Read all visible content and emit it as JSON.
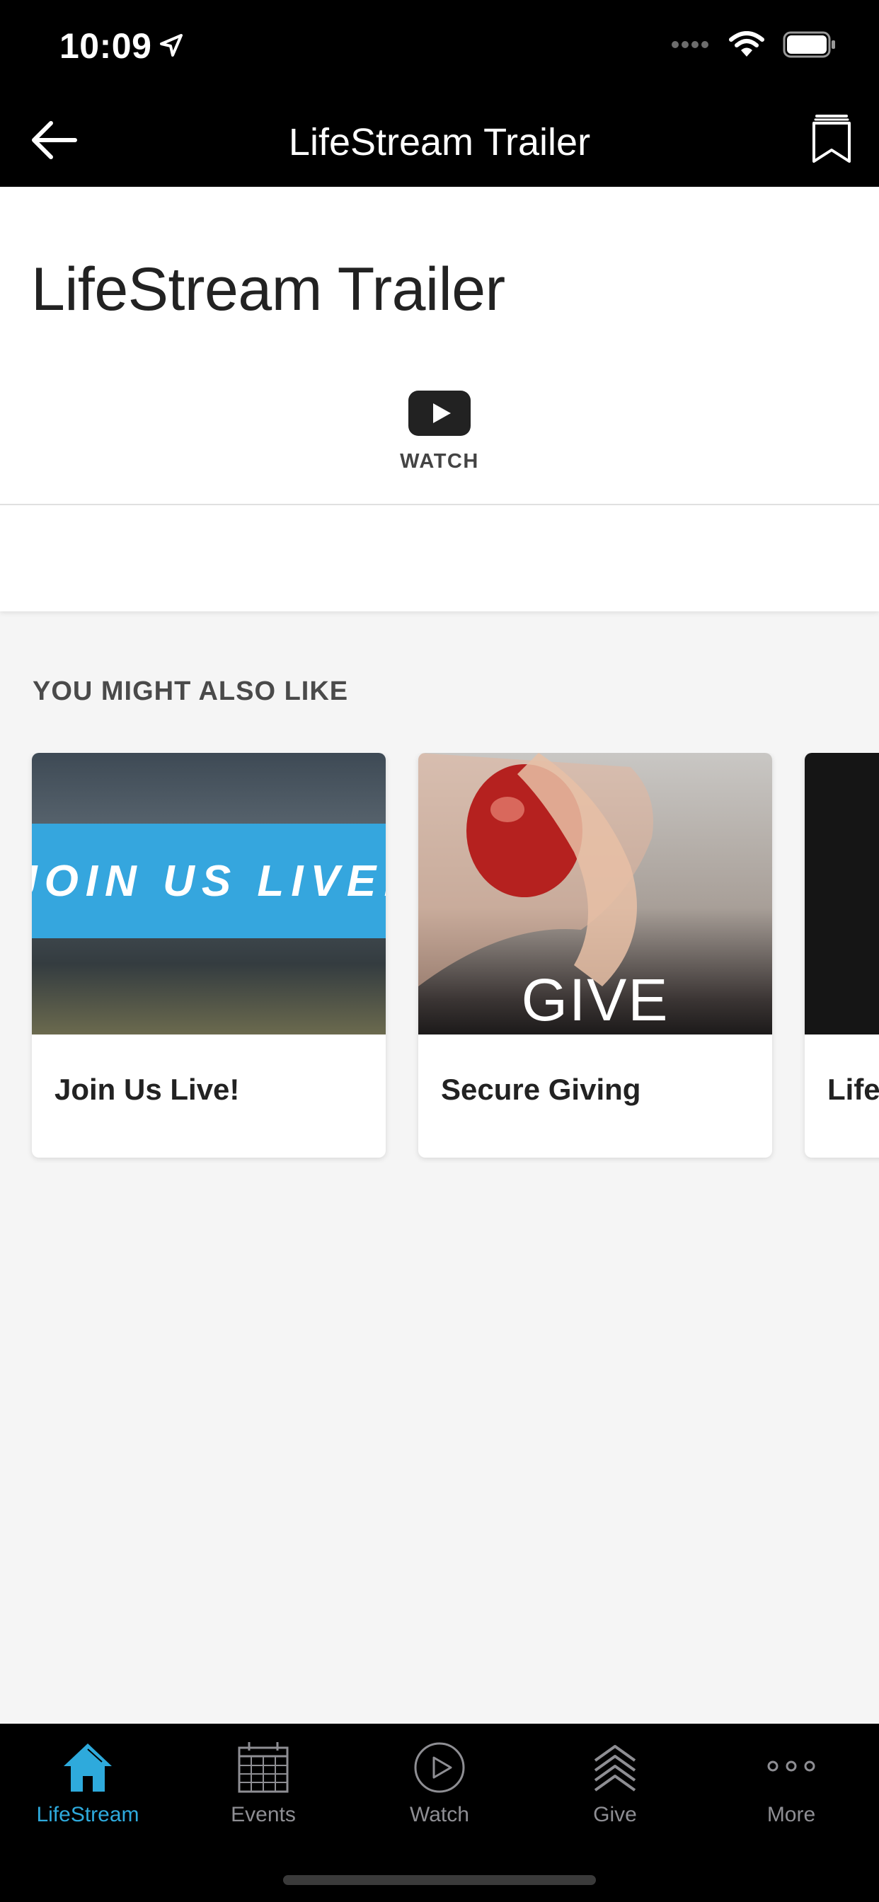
{
  "status": {
    "time": "10:09"
  },
  "nav": {
    "title": "LifeStream Trailer"
  },
  "content": {
    "title": "LifeStream Trailer",
    "watch_label": "WATCH"
  },
  "related": {
    "heading": "YOU MIGHT ALSO LIKE",
    "cards": [
      {
        "title": "Join Us Live!",
        "thumb_text": "JOIN US LIVE!"
      },
      {
        "title": "Secure Giving",
        "thumb_text": "GIVE"
      },
      {
        "title": "Life"
      }
    ]
  },
  "tabs": [
    {
      "label": "LifeStream",
      "icon": "home-icon",
      "active": true
    },
    {
      "label": "Events",
      "icon": "calendar-icon"
    },
    {
      "label": "Watch",
      "icon": "play-circle-icon"
    },
    {
      "label": "Give",
      "icon": "give-icon"
    },
    {
      "label": "More",
      "icon": "more-icon"
    }
  ],
  "colors": {
    "accent": "#2eaadc",
    "live_band": "#35a6de"
  }
}
